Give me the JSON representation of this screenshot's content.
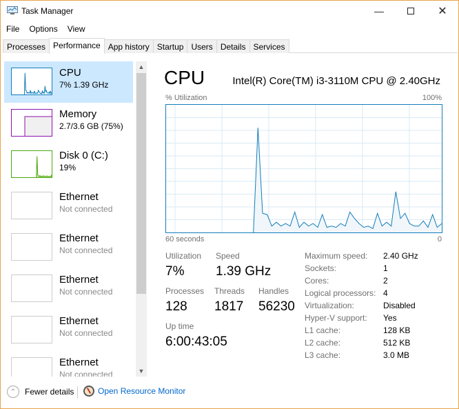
{
  "window": {
    "title": "Task Manager",
    "controls": [
      "minimize",
      "maximize",
      "close"
    ],
    "border_color": "#e6a24a"
  },
  "menu": [
    "File",
    "Options",
    "View"
  ],
  "tabs": [
    {
      "label": "Processes"
    },
    {
      "label": "Performance",
      "active": true
    },
    {
      "label": "App history"
    },
    {
      "label": "Startup"
    },
    {
      "label": "Users"
    },
    {
      "label": "Details"
    },
    {
      "label": "Services"
    }
  ],
  "sidebar": {
    "items": [
      {
        "name": "CPU",
        "sub": "7%  1.39 GHz",
        "color": "#117dbb",
        "selected": true
      },
      {
        "name": "Memory",
        "sub": "2.7/3.6 GB (75%)",
        "color": "#8b12ae"
      },
      {
        "name": "Disk 0 (C:)",
        "sub": "19%",
        "color": "#4da60c"
      },
      {
        "name": "Ethernet",
        "sub": "Not connected"
      },
      {
        "name": "Ethernet",
        "sub": "Not connected"
      },
      {
        "name": "Ethernet",
        "sub": "Not connected"
      },
      {
        "name": "Ethernet",
        "sub": "Not connected"
      },
      {
        "name": "Ethernet",
        "sub": "Not connected"
      }
    ]
  },
  "main": {
    "title": "CPU",
    "model": "Intel(R) Core(TM) i3-3110M CPU @ 2.40GHz",
    "y_label": "% Utilization",
    "y_max_label": "100%",
    "x_left_label": "60 seconds",
    "x_right_label": "0",
    "stats": {
      "utilization_label": "Utilization",
      "utilization": "7%",
      "speed_label": "Speed",
      "speed": "1.39 GHz",
      "processes_label": "Processes",
      "processes": "128",
      "threads_label": "Threads",
      "threads": "1817",
      "handles_label": "Handles",
      "handles": "56230",
      "uptime_label": "Up time",
      "uptime": "6:00:43:05"
    },
    "specs": [
      {
        "k": "Maximum speed:",
        "v": "2.40 GHz"
      },
      {
        "k": "Sockets:",
        "v": "1"
      },
      {
        "k": "Cores:",
        "v": "2"
      },
      {
        "k": "Logical processors:",
        "v": "4"
      },
      {
        "k": "Virtualization:",
        "v": "Disabled"
      },
      {
        "k": "Hyper-V support:",
        "v": "Yes"
      },
      {
        "k": "L1 cache:",
        "v": "128 KB"
      },
      {
        "k": "L2 cache:",
        "v": "512 KB"
      },
      {
        "k": "L3 cache:",
        "v": "3.0 MB"
      }
    ]
  },
  "chart_data": {
    "type": "area",
    "xlabel": "60 seconds",
    "ylabel": "% Utilization",
    "xlim": [
      60,
      0
    ],
    "ylim": [
      0,
      100
    ],
    "grid": true,
    "color": "#117dbb",
    "x_seconds_ago": [
      41,
      40,
      39,
      38,
      37,
      36,
      35,
      34,
      33,
      32,
      31,
      30,
      29,
      28,
      27,
      26,
      25,
      24,
      23,
      22,
      21,
      20,
      19,
      18,
      17,
      16,
      15,
      14,
      13,
      12,
      11,
      10,
      9,
      8,
      7,
      6,
      5,
      4,
      3,
      2,
      1,
      0
    ],
    "values": [
      0,
      82,
      15,
      14,
      5,
      8,
      5,
      7,
      5,
      16,
      4,
      8,
      5,
      7,
      4,
      14,
      4,
      5,
      4,
      7,
      5,
      16,
      11,
      7,
      4,
      5,
      3,
      15,
      5,
      8,
      5,
      32,
      11,
      15,
      7,
      5,
      5,
      9,
      4,
      14,
      4,
      7
    ]
  },
  "footer": {
    "fewer_details": "Fewer details",
    "open_monitor": "Open Resource Monitor"
  }
}
